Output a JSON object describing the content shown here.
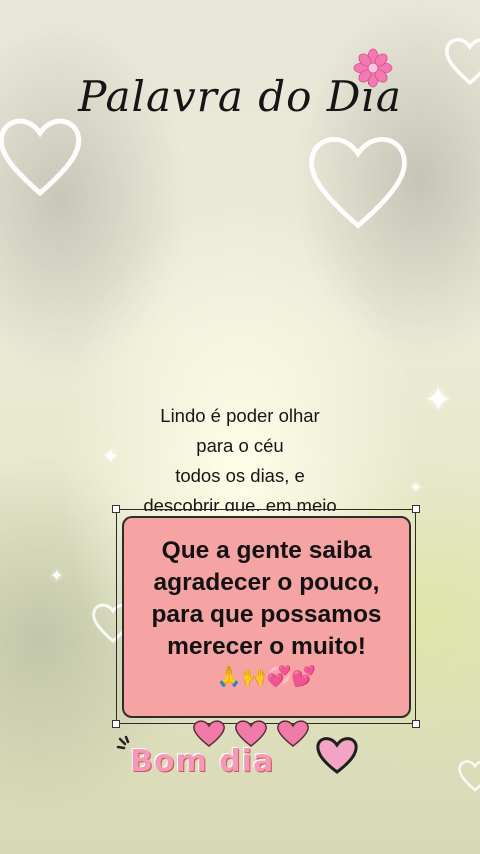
{
  "title": "Palavra do Dia",
  "background_text": {
    "lines": [
      "Lindo é poder olhar",
      "para o céu",
      "todos os dias, e",
      "descobrir que, em meio"
    ]
  },
  "card": {
    "lines": [
      "Que a gente saiba",
      "agradecer o pouco,",
      "para que possamos",
      "merecer o muito!"
    ],
    "emojis": "🙏🙌💞💕"
  },
  "footer": {
    "greeting": "Bom dia"
  },
  "colors": {
    "card_bg": "#f6a3a3",
    "greeting": "#f39ab8",
    "hearts": "#f07aa8"
  },
  "icons": [
    "flower-icon",
    "heart-outline-icon",
    "sparkle-icon",
    "pink-heart-icon"
  ]
}
